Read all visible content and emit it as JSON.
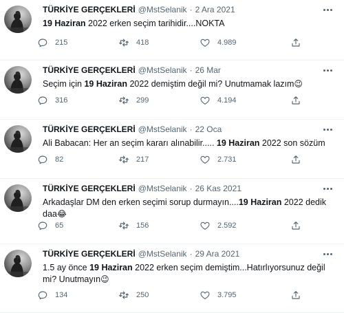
{
  "tweets": [
    {
      "name": "TÜRKİYE GERÇEKLERİ",
      "handle": "@MstSelanik",
      "sep": "·",
      "date": "2 Ara 2021",
      "text": {
        "bold": "19 Haziran",
        "pre": "",
        "post": " 2022 erken seçim tarihidir....NOKTA",
        "emoji": ""
      },
      "replies": "215",
      "retweets": "418",
      "likes": "4.989"
    },
    {
      "name": "TÜRKİYE GERÇEKLERİ",
      "handle": "@MstSelanik",
      "sep": "·",
      "date": "26 Mar",
      "text": {
        "pre": "Seçim için ",
        "bold": "19 Haziran",
        "post": " 2022 demiştim değil mi? Unutmamak lazım",
        "emoji": "😉"
      },
      "replies": "316",
      "retweets": "299",
      "likes": "4.194"
    },
    {
      "name": "TÜRKİYE GERÇEKLERİ",
      "handle": "@MstSelanik",
      "sep": "·",
      "date": "22 Oca",
      "text": {
        "pre": "Ali Babacan: Her an seçim kararı alınabilir..... ",
        "bold": "19 Haziran",
        "post": " 2022 son sözüm",
        "emoji": ""
      },
      "replies": "82",
      "retweets": "217",
      "likes": "2.731"
    },
    {
      "name": "TÜRKİYE GERÇEKLERİ",
      "handle": "@MstSelanik",
      "sep": "·",
      "date": "26 Kas 2021",
      "text": {
        "pre": "Arkadaşlar DM den erken seçimi sorup durmayın....",
        "bold": "19 Haziran",
        "post": " 2022 dedik daa",
        "emoji": "😂"
      },
      "replies": "65",
      "retweets": "156",
      "likes": "2.592"
    },
    {
      "name": "TÜRKİYE GERÇEKLERİ",
      "handle": "@MstSelanik",
      "sep": "·",
      "date": "29 Ara 2021",
      "text": {
        "pre": "1.5 ay önce ",
        "bold": "19 Haziran",
        "post": " 2022 erken seçim demiştim...Hatırlıyorsunuz değil mi? Unutmayın",
        "emoji": "😉"
      },
      "replies": "134",
      "retweets": "250",
      "likes": "3.795"
    }
  ],
  "icons": {
    "avatar": "profile-photo-silhouette",
    "more": "more-horizontal-icon",
    "reply": "reply-icon",
    "retweet": "retweet-icon",
    "like": "heart-icon",
    "share": "share-icon"
  },
  "colors": {
    "text": "#0f1419",
    "secondary": "#536471",
    "divider": "#eff3f4",
    "background": "#ffffff"
  }
}
